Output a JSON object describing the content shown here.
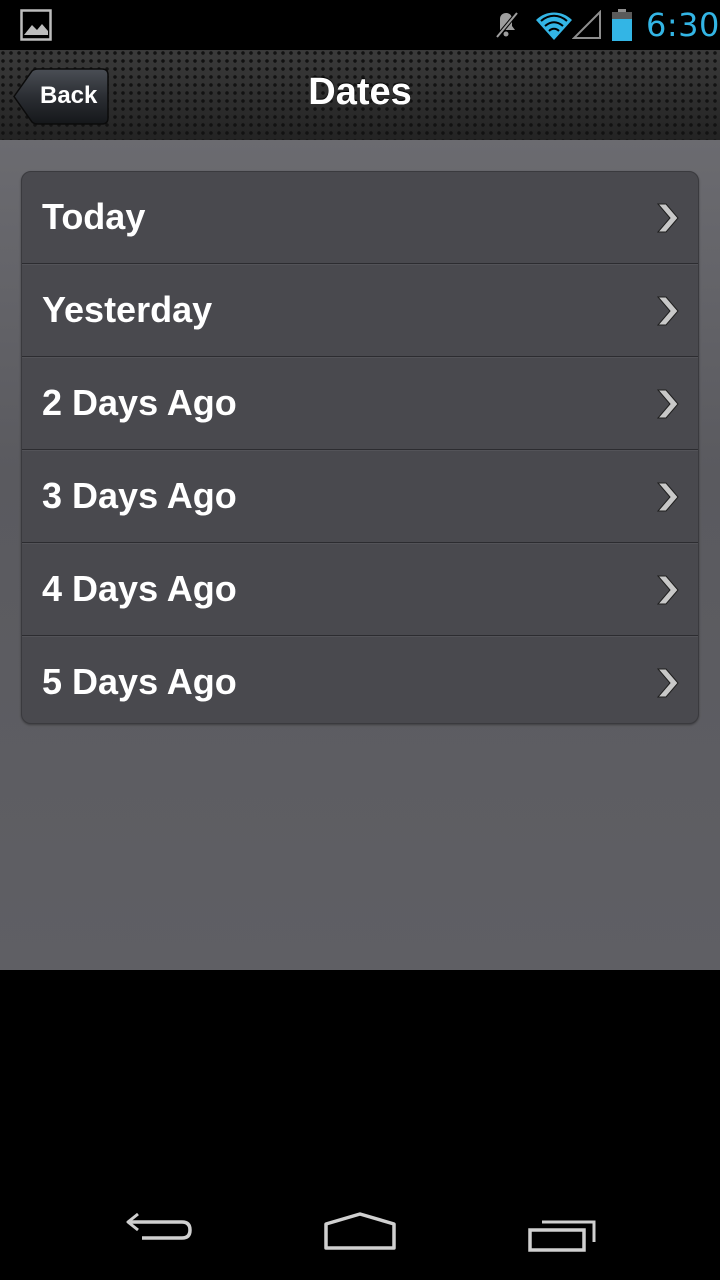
{
  "status_bar": {
    "time": "6:30",
    "icons": [
      "image-notification-icon",
      "mute-icon",
      "wifi-icon",
      "signal-icon",
      "battery-icon"
    ],
    "accent_color": "#33b5e5"
  },
  "header": {
    "back_label": "Back",
    "title": "Dates"
  },
  "list": {
    "items": [
      {
        "label": "Today",
        "icon": "chevron-right-icon"
      },
      {
        "label": "Yesterday",
        "icon": "chevron-right-icon"
      },
      {
        "label": "2 Days Ago",
        "icon": "chevron-right-icon"
      },
      {
        "label": "3 Days Ago",
        "icon": "chevron-right-icon"
      },
      {
        "label": "4 Days Ago",
        "icon": "chevron-right-icon"
      },
      {
        "label": "5 Days Ago",
        "icon": "chevron-right-icon"
      }
    ]
  },
  "nav_bar": {
    "buttons": [
      "back-nav-icon",
      "home-nav-icon",
      "recents-nav-icon"
    ]
  }
}
